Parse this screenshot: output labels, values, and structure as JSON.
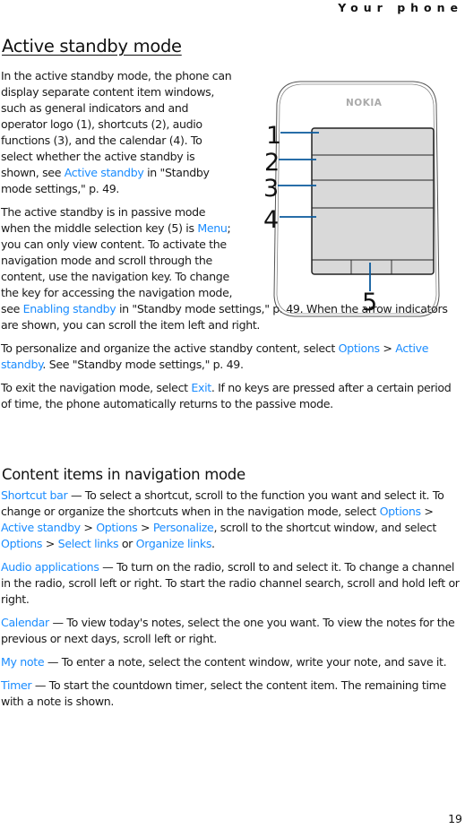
{
  "header": {
    "running_title": "Your phone"
  },
  "section": {
    "title": "Active standby mode",
    "paragraphs": {
      "p1": {
        "t1": "In the active standby mode, the phone can display separate content item windows, such as general indicators and and operator logo (1), shortcuts (2), audio functions (3), and the calendar (4). To select whether the active standby is shown, see ",
        "link1": "Active standby",
        "t2": " in \"Standby mode settings,\" p. 49."
      },
      "p2": {
        "t1": "The active standby is in passive mode when the middle selection key (5) is ",
        "link1": "Menu",
        "t2": "; you can only view content. To activate the navigation mode and scroll through the content, use the navigation key. To change the key for accessing the navigation mode, see ",
        "link2": "Enabling standby",
        "t3": " in \"Standby mode settings,\" p. 49. When the arrow indicators are shown, you can scroll the item left and right."
      },
      "p3": {
        "t1": "To personalize and organize the active standby content, select ",
        "link1": "Options",
        "sep1": " > ",
        "link2": "Active standby",
        "t2": ". See \"Standby mode settings,\" p. 49."
      },
      "p4": {
        "t1": "To exit the navigation mode, select ",
        "link1": "Exit",
        "t2": ". If no keys are pressed after a certain period of time, the phone automatically returns to the passive mode."
      }
    }
  },
  "figure": {
    "brand": "NOKIA",
    "callouts": [
      "1",
      "2",
      "3",
      "4",
      "5"
    ]
  },
  "subsection": {
    "title": "Content items in navigation mode",
    "items": {
      "shortcut_bar": {
        "term": "Shortcut bar",
        "t1": " — To select a shortcut, scroll to the function you want and select it. To change or organize the shortcuts when in the navigation mode, select ",
        "l1": "Options",
        "s1": " > ",
        "l2": "Active standby",
        "s2": " > ",
        "l3": "Options",
        "s3": " > ",
        "l4": "Personalize",
        "t2": ", scroll to the shortcut window, and select ",
        "l5": "Options",
        "s4": " > ",
        "l6": "Select links",
        "t3": " or ",
        "l7": "Organize links",
        "t4": "."
      },
      "audio": {
        "term": "Audio applications",
        "t1": " — To turn on the radio, scroll to and select it. To change a channel in the radio, scroll left or right. To start the radio channel search, scroll and hold left or right."
      },
      "calendar": {
        "term": "Calendar",
        "t1": " — To view today's notes, select the one you want. To view the notes for the previous or next days, scroll left or right."
      },
      "my_note": {
        "term": "My note",
        "t1": " — To enter a note, select the content window, write your note, and save it."
      },
      "timer": {
        "term": "Timer",
        "t1": " — To start the countdown timer, select the content item. The remaining time with a note is shown."
      }
    }
  },
  "footer": {
    "page_number": "19"
  }
}
